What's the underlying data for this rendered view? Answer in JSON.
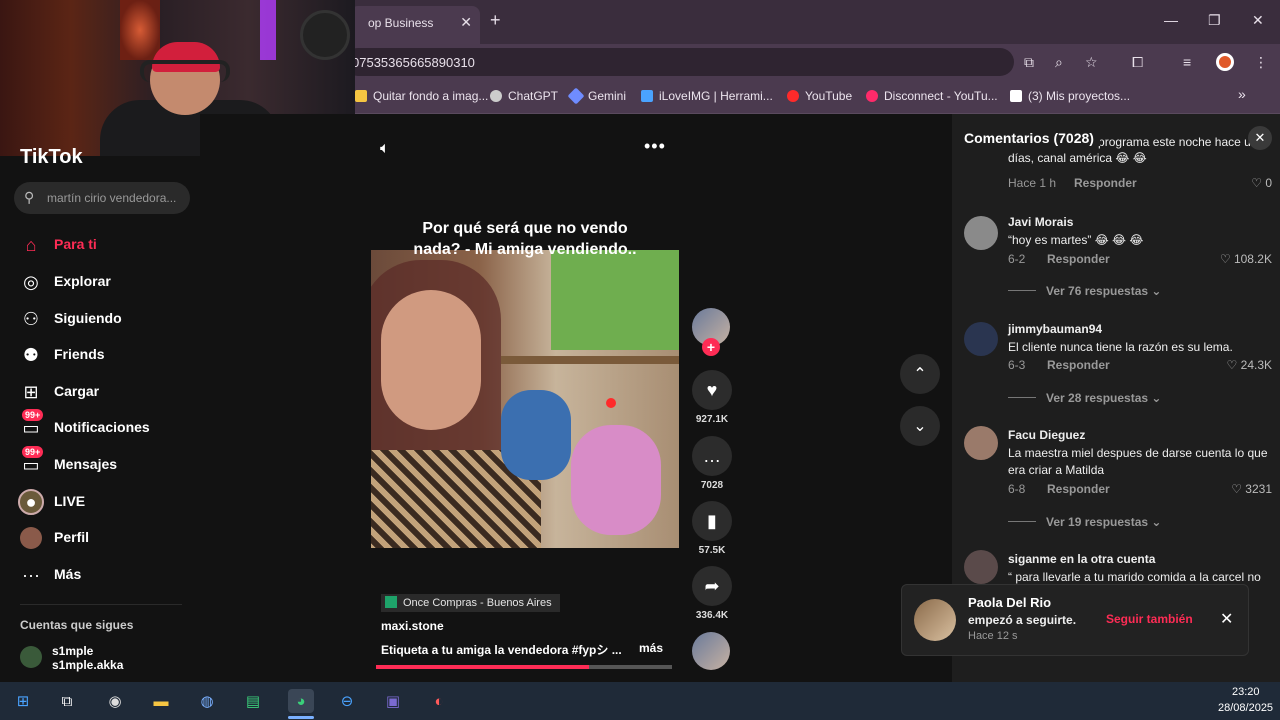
{
  "browser": {
    "tab_title": "op Business",
    "url": "0753536566589031​0",
    "bookmarks": [
      {
        "label": "Quitar fondo a imag...",
        "icon": "image-icon",
        "color": "#f5c542"
      },
      {
        "label": "ChatGPT",
        "icon": "chatgpt-icon",
        "color": "#cccccc"
      },
      {
        "label": "Gemini",
        "icon": "gemini-icon",
        "color": "#6f8cff"
      },
      {
        "label": "iLoveIMG | Herrami...",
        "icon": "heart-icon",
        "color": "#4aa3ff"
      },
      {
        "label": "YouTube",
        "icon": "youtube-icon",
        "color": "#ff2a2a"
      },
      {
        "label": "Disconnect - YouTu...",
        "icon": "youtube-icon",
        "color": "#ff2a6a"
      },
      {
        "label": "(3)  Mis proyectos...",
        "icon": "notion-icon",
        "color": "#ffffff"
      }
    ]
  },
  "tiktok": {
    "logo": "TikTok",
    "search_placeholder": "martín cirio vendedora...",
    "nav": [
      {
        "label": "Para ti",
        "icon": "home-icon",
        "active": true
      },
      {
        "label": "Explorar",
        "icon": "compass-icon"
      },
      {
        "label": "Siguiendo",
        "icon": "following-icon"
      },
      {
        "label": "Friends",
        "icon": "friends-icon"
      },
      {
        "label": "Cargar",
        "icon": "upload-icon"
      },
      {
        "label": "Notificaciones",
        "icon": "inbox-icon",
        "badge": "99+"
      },
      {
        "label": "Mensajes",
        "icon": "messages-icon",
        "badge": "99+"
      },
      {
        "label": "LIVE",
        "icon": "live-icon"
      },
      {
        "label": "Perfil",
        "icon": "avatar-icon"
      },
      {
        "label": "Más",
        "icon": "more-icon"
      }
    ],
    "following_heading": "Cuentas que sigues",
    "following_account": {
      "name": "s1mple",
      "username": "s1mple.akka"
    }
  },
  "video": {
    "caption": "Por qué será que no vendo nada? - Mi amiga vendiendo..",
    "likes": "927.1K",
    "comments": "7028",
    "saves": "57.5K",
    "shares": "336.4K",
    "location": "Once Compras - Buenos Aires",
    "author": "maxi.stone",
    "description": "Etiqueta a tu amiga la vendedora #fypシ ...",
    "more": "más",
    "progress": 0.72
  },
  "comments": {
    "header": "Comentarios (7028)",
    "partial_text": "ella estuvo en el programa este noche hace unos días, canal américa 😂 😂",
    "partial_meta": "Hace 1 h",
    "partial_likes": "0",
    "reply_label": "Responder",
    "items": [
      {
        "user": "Javi Morais",
        "text": "“hoy es martes” 😂 😂 😂",
        "date": "6-2",
        "likes": "108.2K",
        "view": "Ver 76 respuestas",
        "avatar": "#8a8a8a"
      },
      {
        "user": "jimmybauman94",
        "text": "El cliente nunca tiene la razón es su lema.",
        "date": "6-3",
        "likes": "24.3K",
        "view": "Ver 28 respuestas",
        "avatar": "#2a3550"
      },
      {
        "user": "Facu Dieguez",
        "text": "La maestra miel despues de darse cuenta lo que era criar a Matilda",
        "date": "6-8",
        "likes": "3231",
        "view": "Ver 19 respuestas",
        "avatar": "#9a7a6a"
      },
      {
        "user": "siganme en la otra cuenta",
        "text": "“ para llevarle a tu marido comida a la carcel no",
        "avatar": "#5a4a4a"
      }
    ]
  },
  "toast": {
    "name": "Paola Del Rio",
    "message": "empezó a seguirte.",
    "time": "Hace 12 s",
    "button": "Seguir también"
  },
  "taskbar": {
    "time": "23:20",
    "date": "28/08/2025"
  }
}
